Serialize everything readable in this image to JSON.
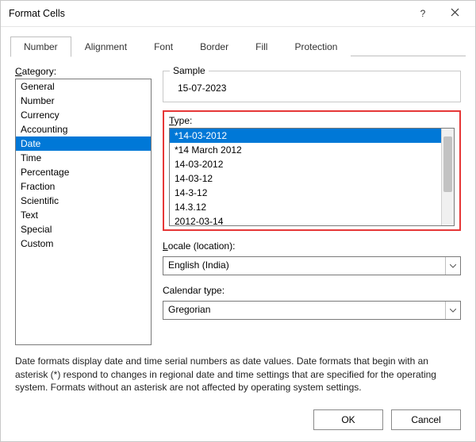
{
  "titlebar": {
    "title": "Format Cells"
  },
  "tabs": [
    {
      "label": "Number",
      "active": true
    },
    {
      "label": "Alignment",
      "active": false
    },
    {
      "label": "Font",
      "active": false
    },
    {
      "label": "Border",
      "active": false
    },
    {
      "label": "Fill",
      "active": false
    },
    {
      "label": "Protection",
      "active": false
    }
  ],
  "category": {
    "label_pre": "C",
    "label_post": "ategory:",
    "items": [
      {
        "label": "General",
        "selected": false
      },
      {
        "label": "Number",
        "selected": false
      },
      {
        "label": "Currency",
        "selected": false
      },
      {
        "label": "Accounting",
        "selected": false
      },
      {
        "label": "Date",
        "selected": true
      },
      {
        "label": "Time",
        "selected": false
      },
      {
        "label": "Percentage",
        "selected": false
      },
      {
        "label": "Fraction",
        "selected": false
      },
      {
        "label": "Scientific",
        "selected": false
      },
      {
        "label": "Text",
        "selected": false
      },
      {
        "label": "Special",
        "selected": false
      },
      {
        "label": "Custom",
        "selected": false
      }
    ]
  },
  "sample": {
    "legend": "Sample",
    "value": "15-07-2023"
  },
  "type": {
    "label_pre": "T",
    "label_post": "ype:",
    "items": [
      {
        "label": "*14-03-2012",
        "selected": true
      },
      {
        "label": "*14 March 2012",
        "selected": false
      },
      {
        "label": "14-03-2012",
        "selected": false
      },
      {
        "label": "14-03-12",
        "selected": false
      },
      {
        "label": "14-3-12",
        "selected": false
      },
      {
        "label": "14.3.12",
        "selected": false
      },
      {
        "label": "2012-03-14",
        "selected": false
      }
    ]
  },
  "locale": {
    "label_pre": "L",
    "label_post": "ocale (location):",
    "value": "English (India)"
  },
  "calendar": {
    "label": "Calendar type:",
    "value": "Gregorian"
  },
  "description": "Date formats display date and time serial numbers as date values.  Date formats that begin with an asterisk (*) respond to changes in regional date and time settings that are specified for the operating system. Formats without an asterisk are not affected by operating system settings.",
  "buttons": {
    "ok": "OK",
    "cancel": "Cancel"
  }
}
